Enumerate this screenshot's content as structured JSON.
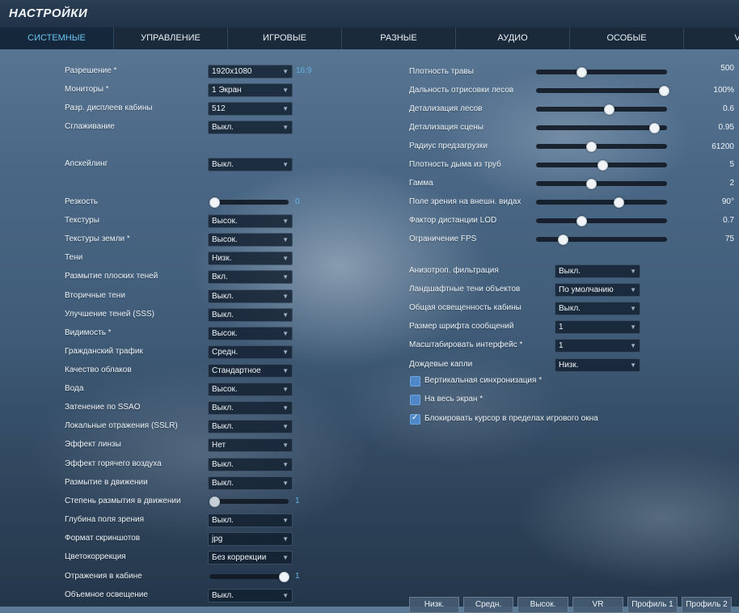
{
  "title": "НАСТРОЙКИ",
  "tabs": [
    "СИСТЕМНЫЕ",
    "УПРАВЛЕНИЕ",
    "ИГРОВЫЕ",
    "РАЗНЫЕ",
    "АУДИО",
    "ОСОБЫЕ",
    "VR"
  ],
  "left": {
    "resolution": {
      "label": "Разрешение *",
      "value": "1920x1080",
      "ratio": "16:9"
    },
    "monitors": {
      "label": "Мониторы *",
      "value": "1 Экран"
    },
    "cockpit_displays": {
      "label": "Разр. дисплеев кабины",
      "value": "512"
    },
    "antialiasing": {
      "label": "Сглаживание",
      "value": "Выкл."
    },
    "upscaling": {
      "label": "Апскейлинг",
      "value": "Выкл."
    },
    "sharpness": {
      "label": "Резкость",
      "value": "0",
      "level": 0
    },
    "textures": {
      "label": "Текстуры",
      "value": "Высок."
    },
    "terrain_textures": {
      "label": "Текстуры земли *",
      "value": "Высок."
    },
    "shadows": {
      "label": "Тени",
      "value": "Низк."
    },
    "flat_shadow_blur": {
      "label": "Размытие плоских теней",
      "value": "Вкл."
    },
    "secondary_shadows": {
      "label": "Вторичные тени",
      "value": "Выкл."
    },
    "sss": {
      "label": "Улучшение теней (SSS)",
      "value": "Выкл."
    },
    "visibility": {
      "label": "Видимость *",
      "value": "Высок."
    },
    "civil_traffic": {
      "label": "Гражданский трафик",
      "value": "Средн."
    },
    "clouds": {
      "label": "Качество облаков",
      "value": "Стандартное"
    },
    "water": {
      "label": "Вода",
      "value": "Высок."
    },
    "ssao": {
      "label": "Затенение по SSAO",
      "value": "Выкл."
    },
    "sslr": {
      "label": "Локальные отражения (SSLR)",
      "value": "Выкл."
    },
    "lens": {
      "label": "Эффект линзы",
      "value": "Нет"
    },
    "heat_blur": {
      "label": "Эффект горячего воздуха",
      "value": "Выкл."
    },
    "motion_blur": {
      "label": "Размытие в движении",
      "value": "Выкл."
    },
    "motion_blur_amount": {
      "label": "Степень размытия в движении",
      "value": "1",
      "level": 0
    },
    "dof": {
      "label": "Глубина поля зрения",
      "value": "Выкл."
    },
    "screenshot_format": {
      "label": "Формат скриншотов",
      "value": "jpg"
    },
    "color_grading": {
      "label": "Цветокоррекция",
      "value": "Без коррекции"
    },
    "cockpit_reflections": {
      "label": "Отражения в кабине",
      "value": "1",
      "level": 1
    },
    "volumetric_light": {
      "label": "Объемное освещение",
      "value": "Выкл."
    }
  },
  "right": {
    "sliders": [
      {
        "label": "Плотность травы",
        "value": "500",
        "level": 0.33
      },
      {
        "label": "Дальность отрисовки лесов",
        "value": "100%",
        "level": 1.0
      },
      {
        "label": "Детализация лесов",
        "value": "0.6",
        "level": 0.55
      },
      {
        "label": "Детализация сцены",
        "value": "0.95",
        "level": 0.92
      },
      {
        "label": "Радиус предзагрузки",
        "value": "61200",
        "level": 0.41
      },
      {
        "label": "Плотность дыма из труб",
        "value": "5",
        "level": 0.5
      },
      {
        "label": "Гамма",
        "value": "2",
        "level": 0.41
      },
      {
        "label": "Поле зрения на внешн. видах",
        "value": "90°",
        "level": 0.63
      },
      {
        "label": "Фактор дистанции LOD",
        "value": "0.7",
        "level": 0.33
      },
      {
        "label": "Ограничение FPS",
        "value": "75",
        "level": 0.18
      }
    ],
    "dropdowns": [
      {
        "label": "Анизотроп. фильтрация",
        "value": "Выкл."
      },
      {
        "label": "Ландшафтные тени объектов",
        "value": "По умолчанию"
      },
      {
        "label": "Общая освещенность кабины",
        "value": "Выкл."
      },
      {
        "label": "Размер шрифта сообщений",
        "value": "1"
      },
      {
        "label": "Масштабировать интерфейс *",
        "value": "1"
      },
      {
        "label": "Дождевые капли",
        "value": "Низк."
      }
    ],
    "checkboxes": [
      {
        "label": "Вертикальная синхронизация *",
        "checked": false
      },
      {
        "label": "На весь экран *",
        "checked": false
      },
      {
        "label": "Блокировать курсор в пределах игрового окна",
        "checked": true
      }
    ]
  },
  "bottom_buttons": [
    "Низк.",
    "Средн.",
    "Высок.",
    "VR",
    "Профиль 1",
    "Профиль 2"
  ],
  "colors": {
    "accent": "#63b4e6",
    "checkbox": "#4f88c9"
  }
}
